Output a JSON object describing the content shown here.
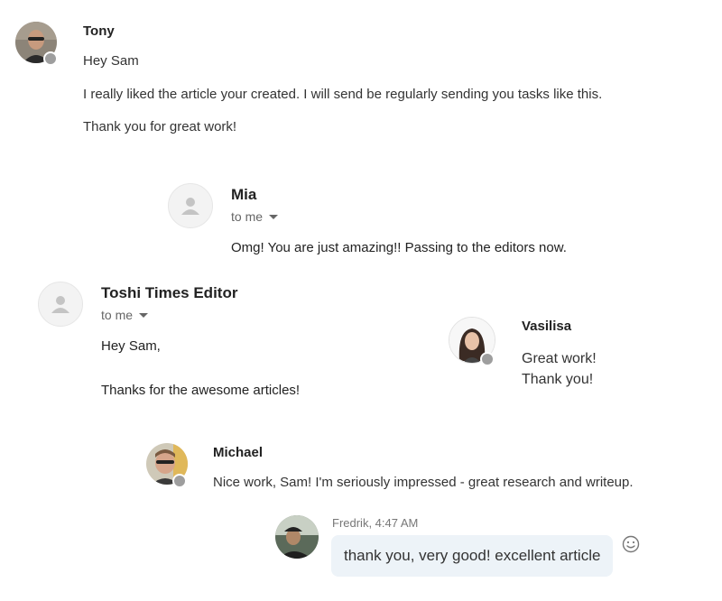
{
  "tony": {
    "name": "Tony",
    "lines": [
      "Hey Sam",
      "I really liked the article your created. I will send be regularly sending you tasks like this.",
      "Thank you for great work!"
    ]
  },
  "mia": {
    "name": "Mia",
    "recipient": "to me",
    "message": "Omg! You are just amazing!! Passing to the editors now."
  },
  "toshi": {
    "name": "Toshi Times Editor",
    "recipient": "to me",
    "lines": [
      "Hey Sam,",
      "Thanks for the awesome articles!"
    ]
  },
  "vasilisa": {
    "name": "Vasilisa",
    "lines": [
      "Great work!",
      "Thank you!"
    ]
  },
  "michael": {
    "name": "Michael",
    "message": "Nice work, Sam! I'm seriously impressed - great research and writeup."
  },
  "fredrik": {
    "meta": "Fredrik, 4:47 AM",
    "message": "thank you, very good! excellent article"
  },
  "colors": {
    "bubble": "#edf3f8",
    "status_offline": "#9e9e9e",
    "text": "#222222"
  },
  "icons": {
    "generic_avatar": "person-icon",
    "reaction": "smiley-icon",
    "dropdown": "chevron-down-icon"
  }
}
